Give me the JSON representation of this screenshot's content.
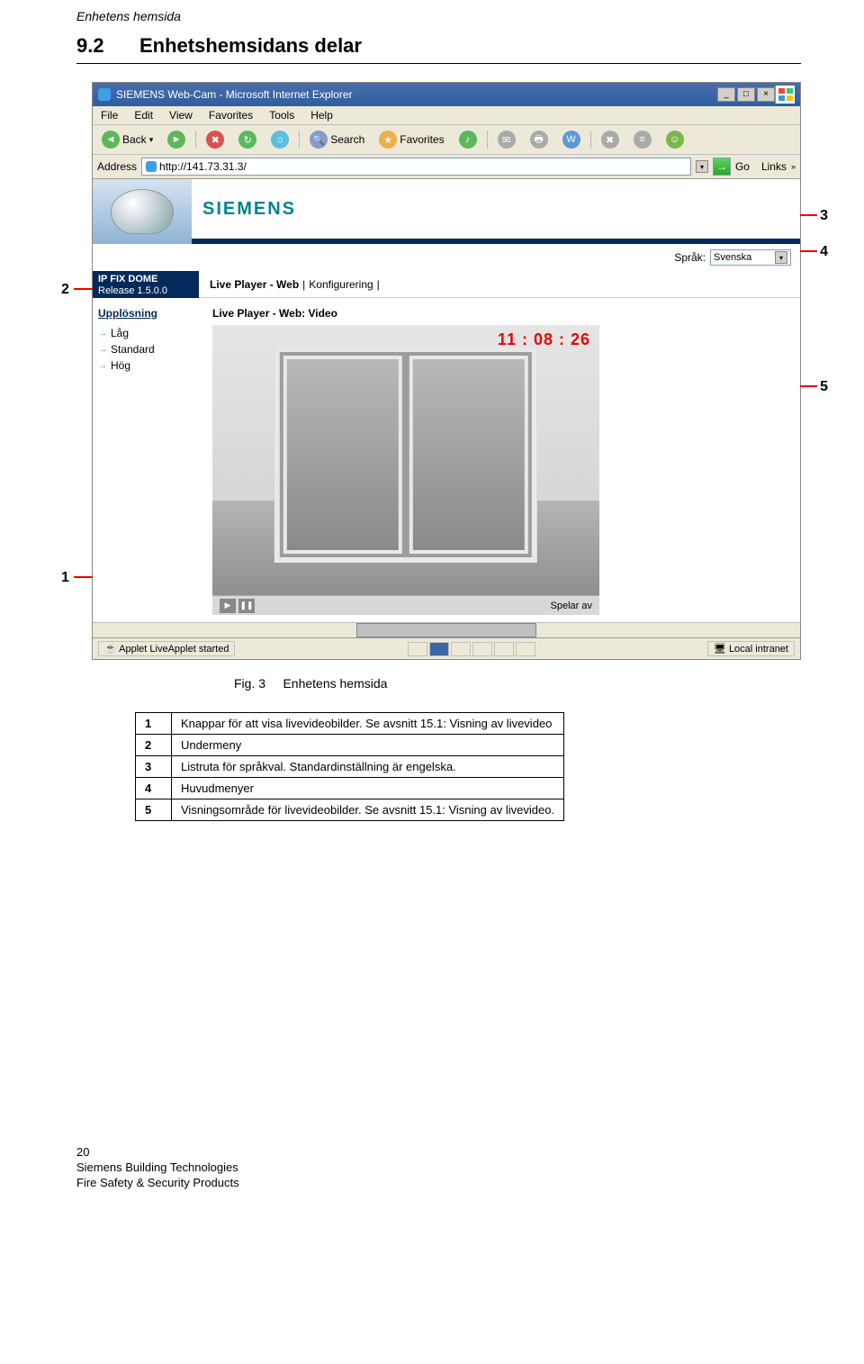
{
  "header_italic": "Enhetens hemsida",
  "section": {
    "num": "9.2",
    "title": "Enhetshemsidans delar"
  },
  "browser": {
    "title": "SIEMENS Web-Cam - Microsoft Internet Explorer",
    "menu": [
      "File",
      "Edit",
      "View",
      "Favorites",
      "Tools",
      "Help"
    ],
    "toolbar": {
      "back": "Back",
      "search": "Search",
      "favorites": "Favorites"
    },
    "address_label": "Address",
    "url": "http://141.73.31.3/",
    "go": "Go",
    "links": "Links"
  },
  "page": {
    "brand": "SIEMENS",
    "lang_label": "Språk:",
    "lang_value": "Svenska",
    "product": "IP FIX DOME",
    "release": "Release 1.5.0.0",
    "tabs": {
      "live": "Live Player - Web",
      "config": "Konfigurering"
    },
    "sidebar": {
      "header": "Upplösning",
      "items": [
        "Låg",
        "Standard",
        "Hög"
      ]
    },
    "content_label": "Live Player - Web: Video",
    "timestamp": "11 : 08 : 26",
    "player_status": "Spelar av",
    "status_left": "Applet LiveApplet started",
    "status_right": "Local intranet"
  },
  "annotations": {
    "a1": "1",
    "a2": "2",
    "a3": "3",
    "a4": "4",
    "a5": "5"
  },
  "figure": {
    "label": "Fig. 3",
    "caption": "Enhetens hemsida"
  },
  "legend": [
    {
      "n": "1",
      "t": "Knappar för att visa livevideobilder. Se avsnitt 15.1: Visning av livevideo"
    },
    {
      "n": "2",
      "t": "Undermeny"
    },
    {
      "n": "3",
      "t": "Listruta för språkval. Standardinställning är engelska."
    },
    {
      "n": "4",
      "t": "Huvudmenyer"
    },
    {
      "n": "5",
      "t": "Visningsområde för livevideobilder. Se avsnitt 15.1: Visning av livevideo."
    }
  ],
  "footer": {
    "pagenum": "20",
    "l1": "Siemens Building Technologies",
    "l2": "Fire Safety & Security Products"
  }
}
